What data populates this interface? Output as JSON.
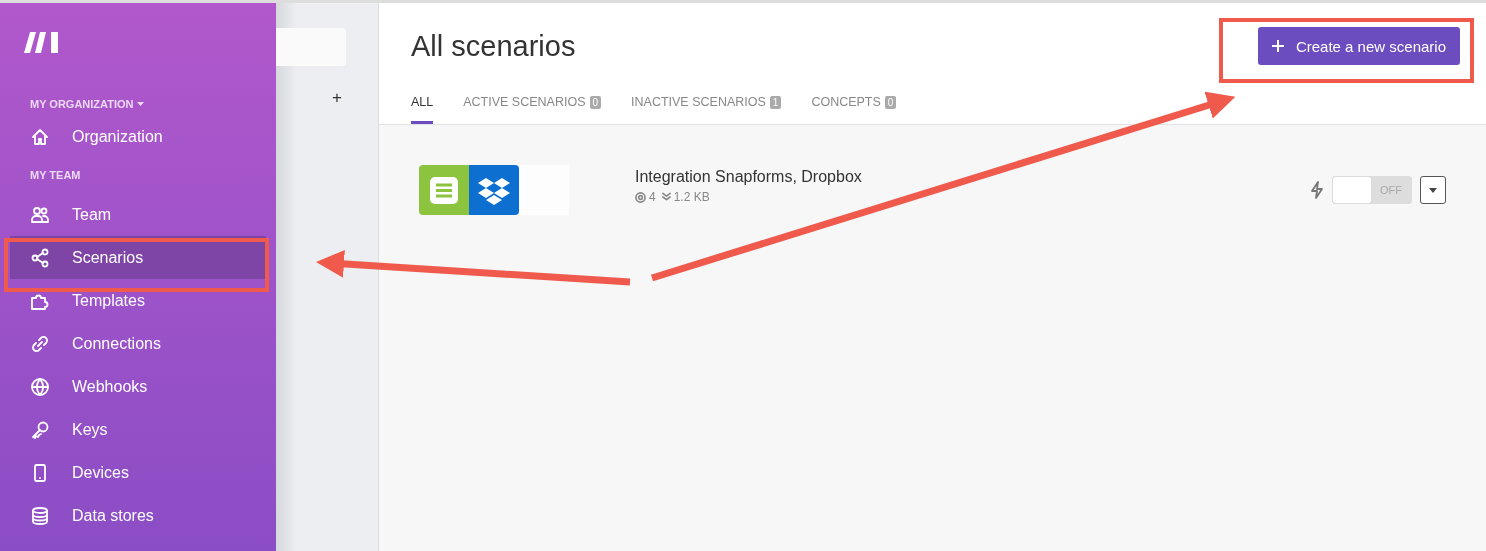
{
  "sidebar": {
    "sections": [
      {
        "label": "MY ORGANIZATION",
        "dropdown": true,
        "items": [
          {
            "label": "Organization",
            "selected": false
          }
        ]
      },
      {
        "label": "MY TEAM",
        "dropdown": false,
        "items": [
          {
            "label": "Team",
            "selected": false
          },
          {
            "label": "Scenarios",
            "selected": true
          },
          {
            "label": "Templates",
            "selected": false
          },
          {
            "label": "Connections",
            "selected": false
          },
          {
            "label": "Webhooks",
            "selected": false
          },
          {
            "label": "Keys",
            "selected": false
          },
          {
            "label": "Devices",
            "selected": false
          },
          {
            "label": "Data stores",
            "selected": false
          }
        ]
      }
    ]
  },
  "side_panel": {
    "add_button": "+"
  },
  "header": {
    "title": "All scenarios",
    "create_button": "Create a new scenario"
  },
  "tabs": [
    {
      "label": "ALL",
      "selected": true
    },
    {
      "label": "ACTIVE SCENARIOS",
      "count": "0",
      "selected": false
    },
    {
      "label": "INACTIVE SCENARIOS",
      "count": "1",
      "selected": false
    },
    {
      "label": "CONCEPTS",
      "count": "0",
      "selected": false
    }
  ],
  "scenarios": [
    {
      "name": "Integration Snapforms, Dropbox",
      "operations": "4",
      "size": "1.2 KB",
      "on": false,
      "toggle_label": "OFF"
    }
  ]
}
